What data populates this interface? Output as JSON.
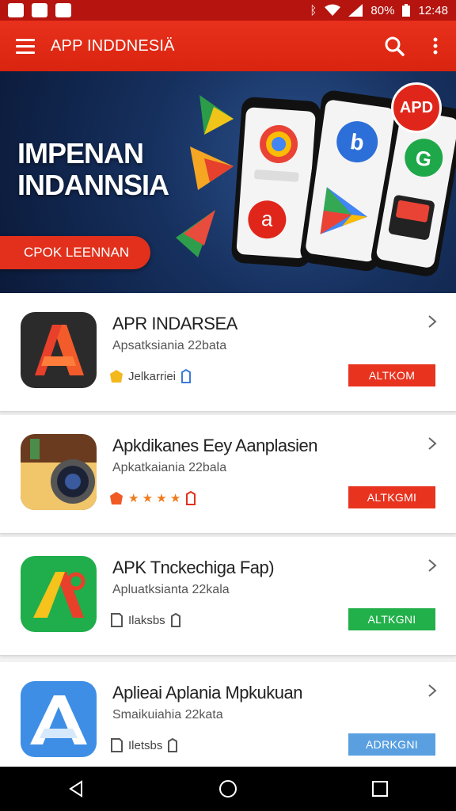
{
  "status_bar": {
    "battery": "80%",
    "time": "12:48"
  },
  "app_bar": {
    "title": "APP INDDNESIÄ"
  },
  "banner": {
    "title": "IMPENAN\nINDANNSIA",
    "cta_label": "CPOK LEENNAN",
    "badge": "APD"
  },
  "apps": [
    {
      "name": "APR INDARSEA",
      "subtitle": "Apsatksiania 22bata",
      "meta": "Jelkarriei",
      "action": "ALTKOM",
      "action_color": "#e8341f",
      "icon": "orange-a-icon"
    },
    {
      "name": "Apkdikanes Eey Aanplasien",
      "subtitle": "Apkatkaiania 22bala",
      "meta": "★ ★ ★ ★",
      "action": "ALTKGMI",
      "action_color": "#e8341f",
      "icon": "camera-icon"
    },
    {
      "name": "APK Tnckechiga Fap)",
      "subtitle": "Apluatksianta 22kala",
      "meta": "Ilaksbs",
      "action": "ALTKGNI",
      "action_color": "#22b04a",
      "icon": "green-a-icon"
    },
    {
      "name": "Aplieai Aplania Mpkukuan",
      "subtitle": "Smaikuiahia 22kata",
      "meta": "Iletsbs",
      "action": "ADRKGNI",
      "action_color": "#5aa0e0",
      "icon": "blue-a-icon"
    }
  ]
}
